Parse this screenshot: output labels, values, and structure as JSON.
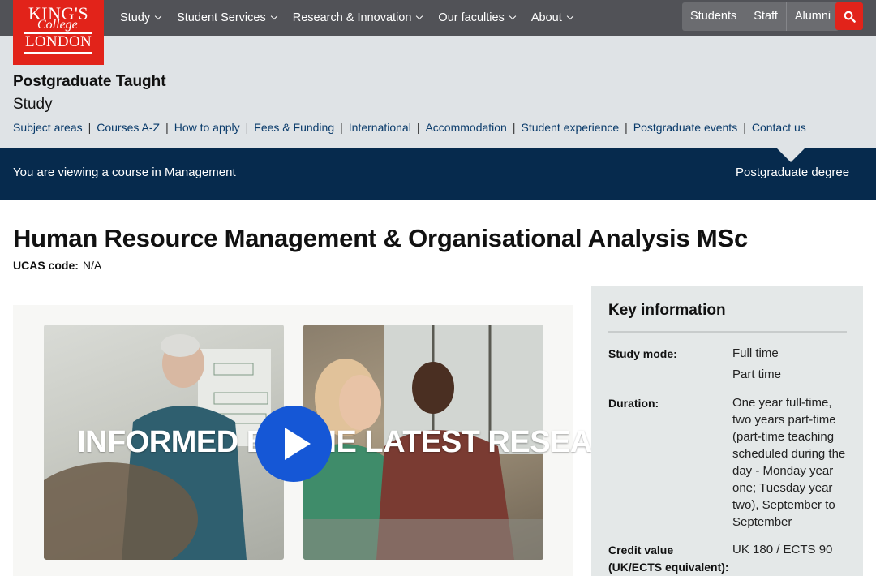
{
  "logo": {
    "line1": "KING'S",
    "line2": "College",
    "line3": "LONDON"
  },
  "main_menu": [
    {
      "label": "Study"
    },
    {
      "label": "Student Services"
    },
    {
      "label": "Research & Innovation"
    },
    {
      "label": "Our faculties"
    },
    {
      "label": "About"
    }
  ],
  "audience_links": [
    "Students",
    "Staff",
    "Alumni"
  ],
  "search_icon": "search-icon",
  "section": {
    "title": "Postgraduate Taught",
    "subtitle": "Study",
    "nav": [
      "Subject areas",
      "Courses A-Z",
      "How to apply",
      "Fees & Funding",
      "International",
      "Accommodation",
      "Student experience",
      "Postgraduate events",
      "Contact us"
    ]
  },
  "viewing": {
    "text": "You are viewing a course in Management",
    "degree": "Postgraduate degree"
  },
  "course": {
    "title": "Human Resource Management & Organisational Analysis MSc",
    "ucas_label": "UCAS code:",
    "ucas_value": "N/A"
  },
  "video": {
    "overlay_text": "INFORMED BY THE LATEST RESEARCH",
    "play_icon": "play-icon"
  },
  "key_info": {
    "title": "Key information",
    "rows": [
      {
        "label": "Study mode:",
        "values": [
          "Full time",
          "Part time"
        ]
      },
      {
        "label": "Duration:",
        "values": [
          "One year full-time, two years part-time (part-time teaching scheduled during the day - Monday year one; Tuesday year two), September to September"
        ]
      },
      {
        "label": "Credit value (UK/ECTS equivalent):",
        "values": [
          "UK 180 / ECTS 90"
        ]
      }
    ]
  },
  "colors": {
    "brand_red": "#e2231a",
    "nav_grey": "#515257",
    "navy": "#062a4d",
    "link_blue": "#0a3b6b",
    "play_blue": "#1557d6"
  }
}
